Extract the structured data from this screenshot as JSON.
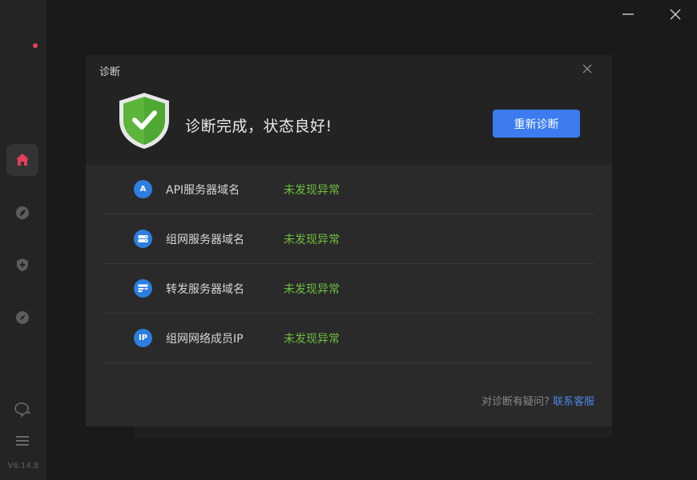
{
  "window": {
    "minimize_icon": "minimize-icon",
    "close_icon": "close-icon"
  },
  "sidebar": {
    "items": [
      {
        "icon": "home-icon",
        "active": true
      },
      {
        "icon": "circle-leaf-icon",
        "active": false
      },
      {
        "icon": "shield-plus-icon",
        "active": false
      },
      {
        "icon": "compass-icon",
        "active": false
      }
    ],
    "bottom": [
      {
        "icon": "chat-bubble-icon"
      },
      {
        "icon": "menu-icon"
      }
    ],
    "version": "V6.14.8"
  },
  "dialog": {
    "title": "诊断",
    "status_text": "诊断完成，状态良好!",
    "rediagnose_label": "重新诊断",
    "items": [
      {
        "icon": "api-icon",
        "icon_text": "A",
        "label": "API服务器域名",
        "status": "未发现异常"
      },
      {
        "icon": "server-icon",
        "icon_text": "",
        "label": "组网服务器域名",
        "status": "未发现异常"
      },
      {
        "icon": "relay-icon",
        "icon_text": "",
        "label": "转发服务器域名",
        "status": "未发现异常"
      },
      {
        "icon": "ip-icon",
        "icon_text": "IP",
        "label": "组网网络成员IP",
        "status": "未发现异常"
      }
    ],
    "footer_question": "对诊断有疑问?",
    "footer_link": "联系客服"
  },
  "colors": {
    "accent": "#3c7cf0",
    "ok_green": "#6cbf3f",
    "shield_green": "#5bb53a",
    "badge_red": "#e83d5c"
  }
}
